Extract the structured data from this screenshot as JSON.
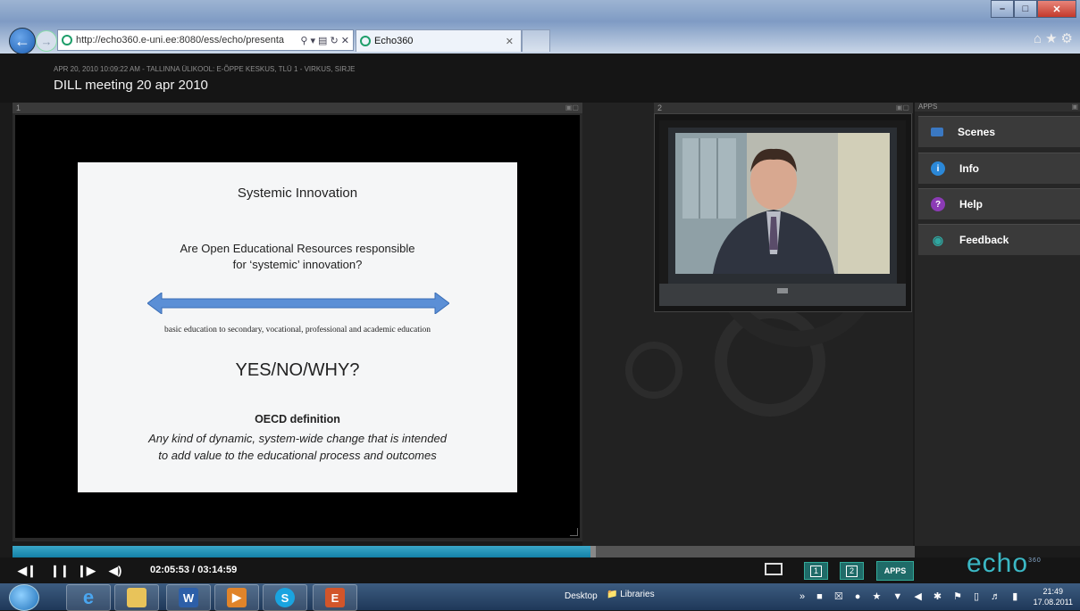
{
  "browser": {
    "url": "http://echo360.e-uni.ee:8080/ess/echo/presenta",
    "tab_title": "Echo360",
    "window_buttons": [
      "–",
      "□",
      "✕"
    ]
  },
  "header": {
    "recording_info": "APR 20, 2010 10:09:22 AM - TALLINNA ÜLIKOOL: E-ÕPPE KESKUS, TLÜ 1 - VIRKUS, SIRJE",
    "title": "DILL meeting 20 apr 2010"
  },
  "panels": {
    "slides": {
      "number": "1",
      "slide": {
        "title": "Systemic Innovation",
        "question_line1": "Are Open Educational Resources responsible",
        "question_line2": "for ‘systemic’ innovation?",
        "basic_line": "basic education to secondary, vocational, professional and academic education",
        "yes_no": "YES/NO/WHY?",
        "oecd_heading": "OECD definition",
        "definition_line1": "Any kind of dynamic, system-wide change that is intended",
        "definition_line2": "to add value to the educational process and outcomes"
      }
    },
    "video": {
      "number": "2"
    },
    "apps": {
      "label": "APPS",
      "items": [
        {
          "label": "Scenes",
          "icon": "scenes-icon",
          "color": "#3a78c2"
        },
        {
          "label": "Info",
          "icon": "info-icon",
          "color": "#2b88d8"
        },
        {
          "label": "Help",
          "icon": "help-icon",
          "color": "#8b3bb5"
        },
        {
          "label": "Feedback",
          "icon": "feedback-icon",
          "color": "#2fa6a0"
        }
      ]
    }
  },
  "player": {
    "progress": 0.644,
    "timecode": "02:05:53 / 03:14:59",
    "screen1": "1",
    "screen2": "2",
    "apps_button": "APPS",
    "logo": "echo",
    "logo_sup": "360"
  },
  "taskbar": {
    "desktop": "Desktop",
    "libraries": "Libraries",
    "time": "21:49",
    "date": "17.08.2011"
  },
  "colors": {
    "accent": "#1480a6",
    "app_button": "#1f6b68",
    "logo": "#3bb8c5"
  }
}
